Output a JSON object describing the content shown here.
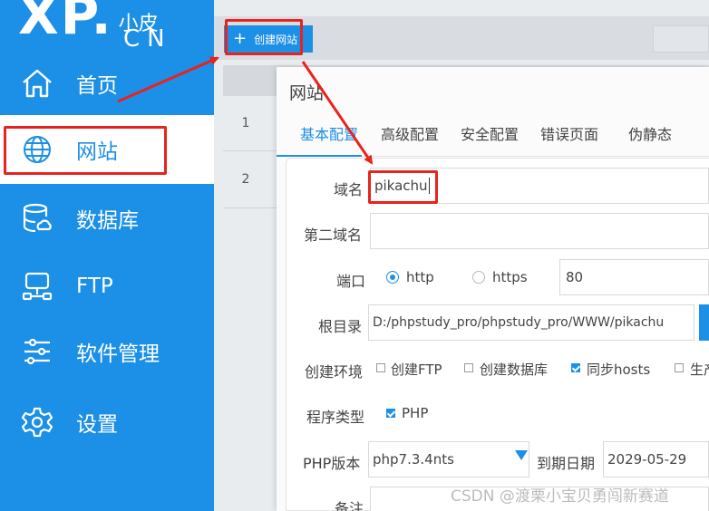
{
  "logo": {
    "main": "XP.",
    "sub": "小皮",
    "cn": "CN"
  },
  "sidebar": {
    "items": [
      {
        "label": "首页",
        "icon": "home-icon"
      },
      {
        "label": "网站",
        "icon": "globe-icon",
        "active": true
      },
      {
        "label": "数据库",
        "icon": "database-icon"
      },
      {
        "label": "FTP",
        "icon": "ftp-server-icon"
      },
      {
        "label": "软件管理",
        "icon": "sliders-icon"
      },
      {
        "label": "设置",
        "icon": "gear-icon"
      }
    ]
  },
  "toolbar": {
    "create_label": "创建网站",
    "create_icon": "plus-icon"
  },
  "table": {
    "rows": [
      "1",
      "2"
    ]
  },
  "dialog": {
    "title": "网站",
    "tabs": [
      "基本配置",
      "高级配置",
      "安全配置",
      "错误页面",
      "伪静态"
    ],
    "active_tab": "基本配置",
    "form": {
      "domain_label": "域名",
      "domain_value": "pikachu",
      "second_domain_label": "第二域名",
      "second_domain_value": "",
      "port_label": "端口",
      "protocols": [
        {
          "label": "http",
          "selected": true
        },
        {
          "label": "https",
          "selected": false
        }
      ],
      "port_value": "80",
      "root_label": "根目录",
      "root_value": "D:/phpstudy_pro/phpstudy_pro/WWW/pikachu",
      "env_label": "创建环境",
      "env_options": [
        {
          "label": "创建FTP",
          "checked": false
        },
        {
          "label": "创建数据库",
          "checked": false
        },
        {
          "label": "同步hosts",
          "checked": true
        },
        {
          "label": "生产",
          "checked": false
        }
      ],
      "program_label": "程序类型",
      "program_options": [
        {
          "label": "PHP",
          "checked": true
        }
      ],
      "php_version_label": "PHP版本",
      "php_version_value": "php7.3.4nts",
      "expire_label": "到期日期",
      "expire_value": "2029-05-29",
      "note_label": "备注"
    }
  },
  "watermark": "CSDN @渡栗小宝贝勇闯新赛道",
  "colors": {
    "accent": "#1c8fe6",
    "highlight": "#e8231e",
    "sidebar_bg": "#1c8fe6"
  }
}
